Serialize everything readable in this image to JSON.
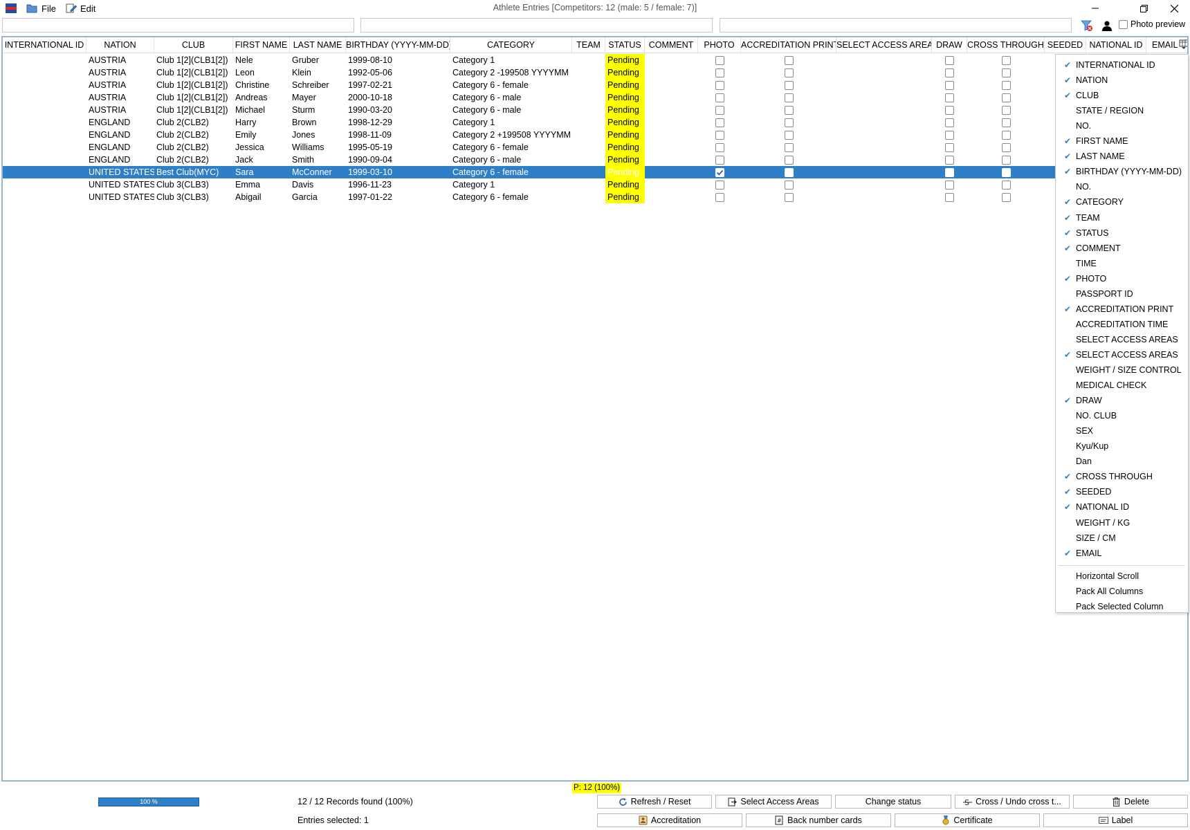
{
  "window": {
    "title": "Athlete Entries [Competitors: 12 (male: 5 / female: 7)]"
  },
  "menu": {
    "file": "File",
    "edit": "Edit"
  },
  "toolbar": {
    "photo_preview": "Photo preview",
    "filter1": "",
    "filter2": "",
    "filter3": ""
  },
  "columns": [
    "INTERNATIONAL ID",
    "NATION",
    "CLUB",
    "FIRST NAME",
    "LAST NAME",
    "BIRTHDAY (YYYY-MM-DD)",
    "CATEGORY",
    "TEAM",
    "STATUS",
    "COMMENT",
    "PHOTO",
    "ACCREDITATION PRINT",
    "SELECT ACCESS AREAS",
    "DRAW",
    "CROSS THROUGH",
    "SEEDED",
    "NATIONAL ID",
    "EMAIL"
  ],
  "rows": [
    {
      "nation": "AUSTRIA",
      "club": "Club 1[2](CLB1[2])",
      "first": "Nele",
      "last": "Gruber",
      "birthday": "1999-08-10",
      "category": "Category 1",
      "status": "Pending",
      "photo": false,
      "selected": false
    },
    {
      "nation": "AUSTRIA",
      "club": "Club 1[2](CLB1[2])",
      "first": "Leon",
      "last": "Klein",
      "birthday": "1992-05-06",
      "category": "Category 2 -199508 YYYYMM",
      "status": "Pending",
      "photo": false,
      "selected": false
    },
    {
      "nation": "AUSTRIA",
      "club": "Club 1[2](CLB1[2])",
      "first": "Christine",
      "last": "Schreiber",
      "birthday": "1997-02-21",
      "category": "Category 6 - female",
      "status": "Pending",
      "photo": false,
      "selected": false
    },
    {
      "nation": "AUSTRIA",
      "club": "Club 1[2](CLB1[2])",
      "first": "Andreas",
      "last": "Mayer",
      "birthday": "2000-10-18",
      "category": "Category 6 - male",
      "status": "Pending",
      "photo": false,
      "selected": false
    },
    {
      "nation": "AUSTRIA",
      "club": "Club 1[2](CLB1[2])",
      "first": "Michael",
      "last": "Sturm",
      "birthday": "1990-03-20",
      "category": "Category 6 - male",
      "status": "Pending",
      "photo": false,
      "selected": false
    },
    {
      "nation": "ENGLAND",
      "club": "Club 2(CLB2)",
      "first": "Harry",
      "last": "Brown",
      "birthday": "1998-12-29",
      "category": "Category 1",
      "status": "Pending",
      "photo": false,
      "selected": false
    },
    {
      "nation": "ENGLAND",
      "club": "Club 2(CLB2)",
      "first": "Emily",
      "last": "Jones",
      "birthday": "1998-11-09",
      "category": "Category 2 +199508 YYYYMM",
      "status": "Pending",
      "photo": false,
      "selected": false
    },
    {
      "nation": "ENGLAND",
      "club": "Club 2(CLB2)",
      "first": "Jessica",
      "last": "Williams",
      "birthday": "1995-05-19",
      "category": "Category 6 - female",
      "status": "Pending",
      "photo": false,
      "selected": false
    },
    {
      "nation": "ENGLAND",
      "club": "Club 2(CLB2)",
      "first": "Jack",
      "last": "Smith",
      "birthday": "1990-09-04",
      "category": "Category 6 - male",
      "status": "Pending",
      "photo": false,
      "selected": false
    },
    {
      "nation": "UNITED STATES",
      "club": "Best Club(MYC)",
      "first": "Sara",
      "last": "McConner",
      "birthday": "1999-03-10",
      "category": "Category 6 - female",
      "status": "Pending",
      "photo": true,
      "selected": true
    },
    {
      "nation": "UNITED STATES",
      "club": "Club 3(CLB3)",
      "first": "Emma",
      "last": "Davis",
      "birthday": "1996-11-23",
      "category": "Category 1",
      "status": "Pending",
      "photo": false,
      "selected": false
    },
    {
      "nation": "UNITED STATES",
      "club": "Club 3(CLB3)",
      "first": "Abigail",
      "last": "Garcia",
      "birthday": "1997-01-22",
      "category": "Category 6 - female",
      "status": "Pending",
      "photo": false,
      "selected": false
    }
  ],
  "column_menu": {
    "items": [
      {
        "label": "INTERNATIONAL ID",
        "checked": true
      },
      {
        "label": "NATION",
        "checked": true
      },
      {
        "label": "CLUB",
        "checked": true
      },
      {
        "label": "STATE / REGION",
        "checked": false
      },
      {
        "label": "NO.",
        "checked": false
      },
      {
        "label": "FIRST NAME",
        "checked": true
      },
      {
        "label": "LAST NAME",
        "checked": true
      },
      {
        "label": "BIRTHDAY (YYYY-MM-DD)",
        "checked": true
      },
      {
        "label": "NO.",
        "checked": false
      },
      {
        "label": "CATEGORY",
        "checked": true
      },
      {
        "label": "TEAM",
        "checked": true
      },
      {
        "label": "STATUS",
        "checked": true
      },
      {
        "label": "COMMENT",
        "checked": true
      },
      {
        "label": "TIME",
        "checked": false
      },
      {
        "label": "PHOTO",
        "checked": true
      },
      {
        "label": "PASSPORT ID",
        "checked": false
      },
      {
        "label": "ACCREDITATION PRINT",
        "checked": true
      },
      {
        "label": "ACCREDITATION TIME",
        "checked": false
      },
      {
        "label": "SELECT ACCESS AREAS",
        "checked": false
      },
      {
        "label": "SELECT ACCESS AREAS",
        "checked": true
      },
      {
        "label": "WEIGHT / SIZE CONTROL",
        "checked": false
      },
      {
        "label": "MEDICAL CHECK",
        "checked": false
      },
      {
        "label": "DRAW",
        "checked": true
      },
      {
        "label": "NO. CLUB",
        "checked": false
      },
      {
        "label": "SEX",
        "checked": false
      },
      {
        "label": "Kyu/Kup",
        "checked": false
      },
      {
        "label": "Dan",
        "checked": false
      },
      {
        "label": "CROSS THROUGH",
        "checked": true
      },
      {
        "label": "SEEDED",
        "checked": true
      },
      {
        "label": "NATIONAL ID",
        "checked": true
      },
      {
        "label": "WEIGHT / KG",
        "checked": false
      },
      {
        "label": "SIZE / CM",
        "checked": false
      },
      {
        "label": "EMAIL",
        "checked": true
      }
    ],
    "actions": [
      "Horizontal Scroll",
      "Pack All Columns",
      "Pack Selected Column"
    ]
  },
  "status": {
    "summary": "P: 12 (100%)",
    "progress_label": "100 %",
    "progress_value": 1.0,
    "records": "12 / 12 Records found (100%)",
    "entries_selected": "Entries selected: 1"
  },
  "buttons": {
    "refresh": "Refresh / Reset",
    "select_access_areas": "Select Access Areas",
    "change_status": "Change status",
    "cross": "Cross / Undo cross t...",
    "delete": "Delete",
    "accreditation": "Accreditation",
    "back_number_cards": "Back number cards",
    "certificate": "Certificate",
    "label": "Label"
  },
  "colors": {
    "selection": "#2f7fc8",
    "status_highlight": "#ffff00",
    "frame": "#99b4d1"
  }
}
